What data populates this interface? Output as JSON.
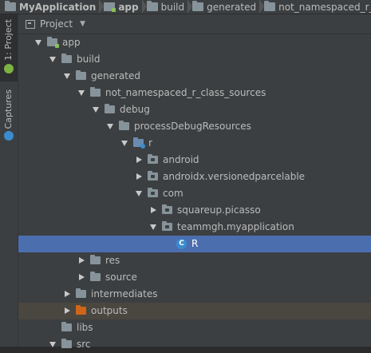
{
  "breadcrumb": [
    {
      "label": "MyApplication",
      "icon": "folder-icon",
      "bold": true
    },
    {
      "label": "app",
      "icon": "module-folder-icon",
      "bold": true
    },
    {
      "label": "build",
      "icon": "folder-icon",
      "bold": false
    },
    {
      "label": "generated",
      "icon": "folder-icon",
      "bold": false
    },
    {
      "label": "not_namespaced_r_class_sources",
      "icon": "folder-icon",
      "bold": false
    }
  ],
  "tool_strip": {
    "project_tab": "1: Project",
    "captures_tab": "Captures",
    "android_icon_color": "#7cb342",
    "captures_icon_color": "#3b8ccf"
  },
  "panel": {
    "title": "Project",
    "dropdown_icon": "caret-down-icon"
  },
  "tree": [
    {
      "label": "app",
      "depth": 0,
      "expanded": true,
      "icon": "module",
      "state": ""
    },
    {
      "label": "build",
      "depth": 1,
      "expanded": true,
      "icon": "folder",
      "state": ""
    },
    {
      "label": "generated",
      "depth": 2,
      "expanded": true,
      "icon": "folder",
      "state": ""
    },
    {
      "label": "not_namespaced_r_class_sources",
      "depth": 3,
      "expanded": true,
      "icon": "folder",
      "state": ""
    },
    {
      "label": "debug",
      "depth": 4,
      "expanded": true,
      "icon": "folder",
      "state": ""
    },
    {
      "label": "processDebugResources",
      "depth": 5,
      "expanded": true,
      "icon": "folder",
      "state": ""
    },
    {
      "label": "r",
      "depth": 6,
      "expanded": true,
      "icon": "res",
      "state": ""
    },
    {
      "label": "android",
      "depth": 7,
      "expanded": false,
      "icon": "pkg",
      "state": ""
    },
    {
      "label": "androidx.versionedparcelable",
      "depth": 7,
      "expanded": false,
      "icon": "pkg",
      "state": ""
    },
    {
      "label": "com",
      "depth": 7,
      "expanded": true,
      "icon": "pkg",
      "state": ""
    },
    {
      "label": "squareup.picasso",
      "depth": 8,
      "expanded": false,
      "icon": "pkg",
      "state": ""
    },
    {
      "label": "teammgh.myapplication",
      "depth": 8,
      "expanded": true,
      "icon": "pkg",
      "state": ""
    },
    {
      "label": "R",
      "depth": 9,
      "expanded": null,
      "icon": "class",
      "state": "selected"
    },
    {
      "label": "res",
      "depth": 3,
      "expanded": false,
      "icon": "folder",
      "state": ""
    },
    {
      "label": "source",
      "depth": 3,
      "expanded": false,
      "icon": "folder",
      "state": ""
    },
    {
      "label": "intermediates",
      "depth": 2,
      "expanded": false,
      "icon": "folder",
      "state": ""
    },
    {
      "label": "outputs",
      "depth": 2,
      "expanded": false,
      "icon": "orange",
      "state": "marked"
    },
    {
      "label": "libs",
      "depth": 1,
      "expanded": null,
      "icon": "folder",
      "state": ""
    },
    {
      "label": "src",
      "depth": 1,
      "expanded": true,
      "icon": "folder",
      "state": ""
    }
  ],
  "colors": {
    "background": "#3c3f41",
    "selection": "#4b6eaf",
    "excluded_row": "#4a4640",
    "class_icon": "#3a8ccf"
  }
}
